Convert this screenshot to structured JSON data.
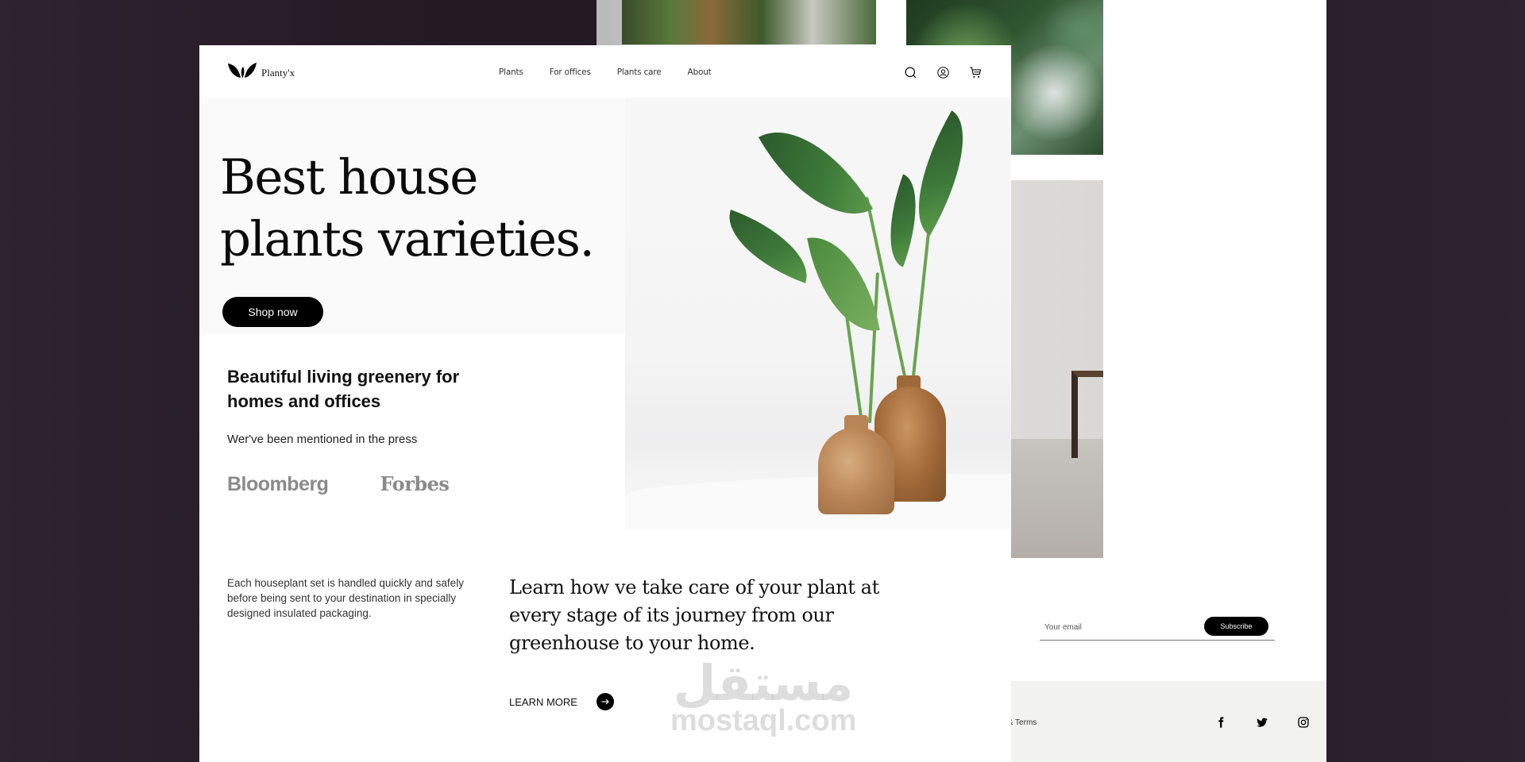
{
  "brand": {
    "name": "Planty'x",
    "logo_icon": "leaf-logo-icon"
  },
  "nav": {
    "links": [
      "Plants",
      "For offices",
      "Plants care",
      "About"
    ],
    "icons": [
      "search-icon",
      "account-icon",
      "cart-icon"
    ]
  },
  "hero": {
    "title_line1": "Best house",
    "title_line2": "plants varieties.",
    "cta_label": "Shop now"
  },
  "intro": {
    "heading": "Beautiful living greenery for homes and offices",
    "press_label": "Wer've been mentioned in the press",
    "press_logos": [
      "Bloomberg",
      "Forbes"
    ]
  },
  "care": {
    "packaging_text": "Each houseplant set is handled quickly and safely before being sent to your destination in specially designed insulated packaging.",
    "statement": "Learn how ve take care of your plant at every stage of its journey from our greenhouse to your home.",
    "learn_more_label": "LEARN MORE",
    "learn_more_icon": "arrow-right-icon"
  },
  "newsletter": {
    "email_placeholder": "Your email",
    "email_value": "",
    "subscribe_label": "Subscribe"
  },
  "footer": {
    "legal_text": "cy & Terms",
    "socials": [
      "facebook-icon",
      "twitter-icon",
      "instagram-icon"
    ]
  },
  "watermark": {
    "arabic": "مستقل",
    "latin": "mostaql.com"
  },
  "colors": {
    "backdrop": "#231a23",
    "backdrop_edge": "#2f2231",
    "primary_button": "#000000",
    "press_logo_gray": "#8a8a8a",
    "hero_left_bg": "#fafafa",
    "footer_bg": "#f2f2f1"
  }
}
